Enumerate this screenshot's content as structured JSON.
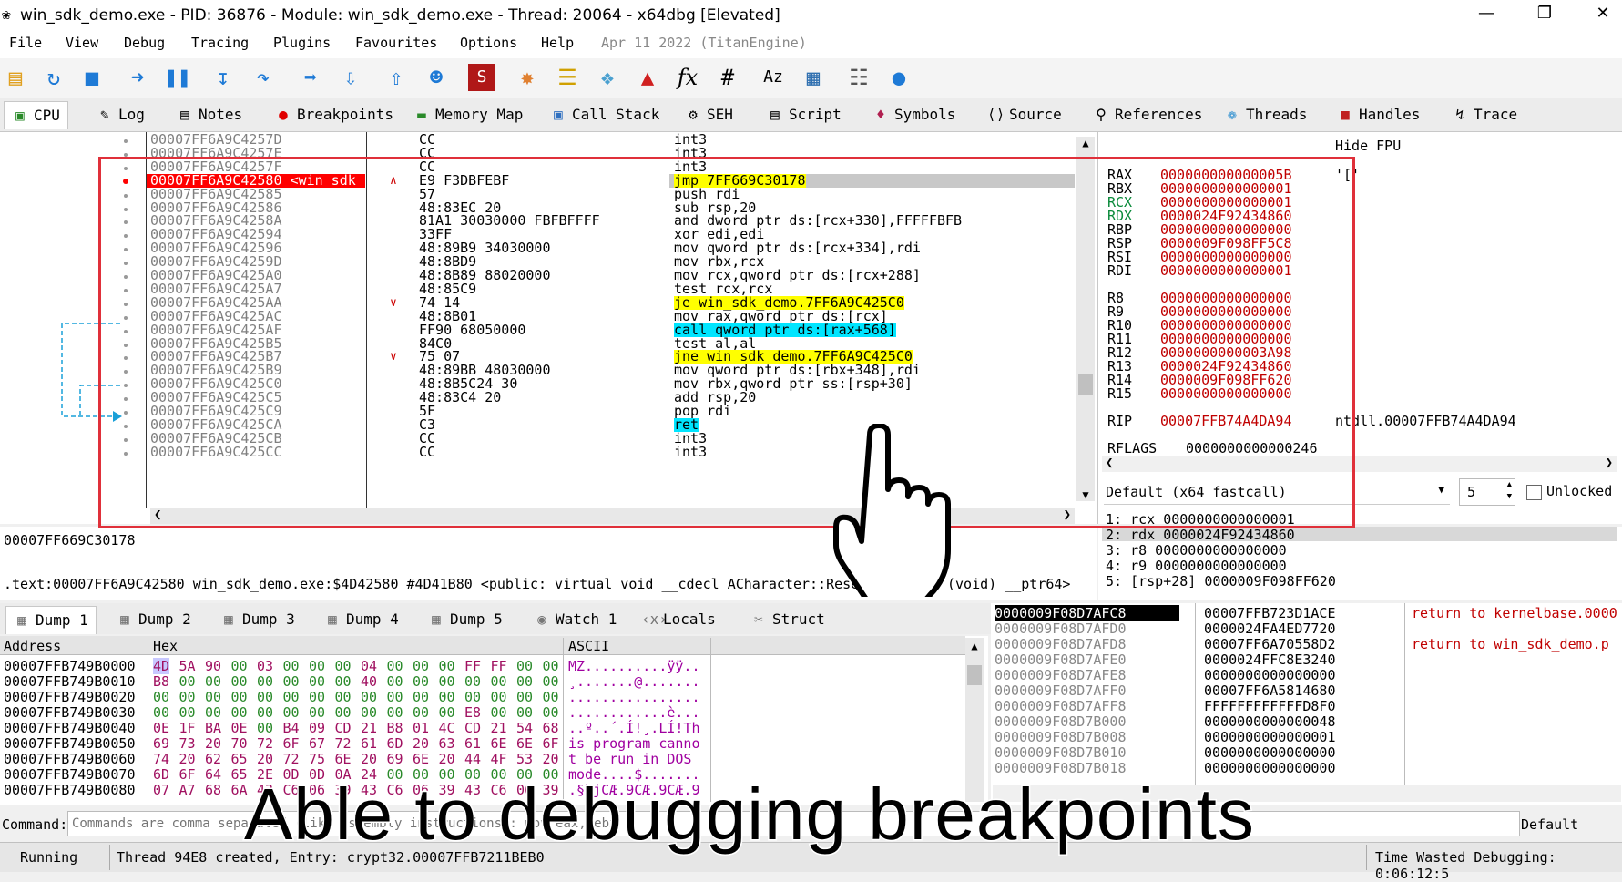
{
  "window": {
    "title": "win_sdk_demo.exe - PID: 36876 - Module: win_sdk_demo.exe - Thread: 20064 - x64dbg [Elevated]"
  },
  "menu": [
    "File",
    "View",
    "Debug",
    "Tracing",
    "Plugins",
    "Favourites",
    "Options",
    "Help"
  ],
  "menu_date": "Apr 11 2022 (TitanEngine)",
  "toolbar_icons": [
    "open-icon",
    "restart-icon",
    "stop-icon",
    "run-icon",
    "pause-icon",
    "step-into-icon",
    "step-over-icon",
    "trace-into-icon",
    "trace-over-icon",
    "execute-till-return-icon",
    "run-to-user-code-icon",
    "script-icon",
    "patch-icon",
    "comment-icon",
    "label-icon",
    "bookmark-icon",
    "function-icon",
    "hash-icon",
    "font-icon",
    "calculator-icon",
    "settings-icon",
    "globe-icon"
  ],
  "toolbar_glyphs": {
    "fx": "fx",
    "hash": "#",
    "font": "Az"
  },
  "tabs": [
    {
      "label": "CPU",
      "icon": "cpu-icon"
    },
    {
      "label": "Log",
      "icon": "log-icon"
    },
    {
      "label": "Notes",
      "icon": "notes-icon"
    },
    {
      "label": "Breakpoints",
      "icon": "breakpoint-icon"
    },
    {
      "label": "Memory Map",
      "icon": "memory-icon"
    },
    {
      "label": "Call Stack",
      "icon": "callstack-icon"
    },
    {
      "label": "SEH",
      "icon": "seh-icon"
    },
    {
      "label": "Script",
      "icon": "script-icon"
    },
    {
      "label": "Symbols",
      "icon": "symbols-icon"
    },
    {
      "label": "Source",
      "icon": "source-icon"
    },
    {
      "label": "References",
      "icon": "references-icon"
    },
    {
      "label": "Threads",
      "icon": "threads-icon"
    },
    {
      "label": "Handles",
      "icon": "handles-icon"
    },
    {
      "label": "Trace",
      "icon": "trace-icon"
    }
  ],
  "disasm": [
    {
      "addr": "00007FF6A9C4257D",
      "bytes": "CC",
      "asm": "int3"
    },
    {
      "addr": "00007FF6A9C4257E",
      "bytes": "CC",
      "asm": "int3"
    },
    {
      "addr": "00007FF6A9C4257F",
      "bytes": "CC",
      "asm": "int3"
    },
    {
      "addr": "00007FF6A9C42580 <win_sdk_",
      "bytes": "E9 F3DBFEBF",
      "asm": "jmp 7FF669C30178",
      "bp": true
    },
    {
      "addr": "00007FF6A9C42585",
      "bytes": "57",
      "asm": "push rdi"
    },
    {
      "addr": "00007FF6A9C42586",
      "bytes": "48:83EC 20",
      "asm": "sub rsp,20"
    },
    {
      "addr": "00007FF6A9C4258A",
      "bytes": "81A1 30030000 FBFBFFFF",
      "asm": "and dword ptr ds:[rcx+330],FFFFFBFB"
    },
    {
      "addr": "00007FF6A9C42594",
      "bytes": "33FF",
      "asm": "xor edi,edi"
    },
    {
      "addr": "00007FF6A9C42596",
      "bytes": "48:89B9 34030000",
      "asm": "mov qword ptr ds:[rcx+334],rdi"
    },
    {
      "addr": "00007FF6A9C4259D",
      "bytes": "48:8BD9",
      "asm": "mov rbx,rcx"
    },
    {
      "addr": "00007FF6A9C425A0",
      "bytes": "48:8B89 88020000",
      "asm": "mov rcx,qword ptr ds:[rcx+288]"
    },
    {
      "addr": "00007FF6A9C425A7",
      "bytes": "48:85C9",
      "asm": "test rcx,rcx"
    },
    {
      "addr": "00007FF6A9C425AA",
      "bytes": "74 14",
      "asm": "je win_sdk_demo.7FF6A9C425C0"
    },
    {
      "addr": "00007FF6A9C425AC",
      "bytes": "48:8B01",
      "asm": "mov rax,qword ptr ds:[rcx]"
    },
    {
      "addr": "00007FF6A9C425AF",
      "bytes": "FF90 68050000",
      "asm": "call qword ptr ds:[rax+568]"
    },
    {
      "addr": "00007FF6A9C425B5",
      "bytes": "84C0",
      "asm": "test al,al"
    },
    {
      "addr": "00007FF6A9C425B7",
      "bytes": "75 07",
      "asm": "jne win_sdk_demo.7FF6A9C425C0"
    },
    {
      "addr": "00007FF6A9C425B9",
      "bytes": "48:89BB 48030000",
      "asm": "mov qword ptr ds:[rbx+348],rdi"
    },
    {
      "addr": "00007FF6A9C425C0",
      "bytes": "48:8B5C24 30",
      "asm": "mov rbx,qword ptr ss:[rsp+30]"
    },
    {
      "addr": "00007FF6A9C425C5",
      "bytes": "48:83C4 20",
      "asm": "add rsp,20"
    },
    {
      "addr": "00007FF6A9C425C9",
      "bytes": "5F",
      "asm": "pop rdi"
    },
    {
      "addr": "00007FF6A9C425CA",
      "bytes": "C3",
      "asm": "ret"
    },
    {
      "addr": "00007FF6A9C425CB",
      "bytes": "CC",
      "asm": "int3"
    },
    {
      "addr": "00007FF6A9C425CC",
      "bytes": "CC",
      "asm": "int3"
    }
  ],
  "regs_header": "Hide FPU",
  "regs": [
    {
      "n": "RAX",
      "v": "000000000000005B",
      "extra": "'['"
    },
    {
      "n": "RBX",
      "v": "0000000000000001"
    },
    {
      "n": "RCX",
      "v": "0000000000000001"
    },
    {
      "n": "RDX",
      "v": "0000024F92434860"
    },
    {
      "n": "RBP",
      "v": "0000000000000000"
    },
    {
      "n": "RSP",
      "v": "0000009F098FF5C8"
    },
    {
      "n": "RSI",
      "v": "0000000000000000"
    },
    {
      "n": "RDI",
      "v": "0000000000000001"
    },
    {
      "n": "R8",
      "v": "0000000000000000"
    },
    {
      "n": "R9",
      "v": "0000000000000000"
    },
    {
      "n": "R10",
      "v": "0000000000000000"
    },
    {
      "n": "R11",
      "v": "0000000000000000"
    },
    {
      "n": "R12",
      "v": "0000000000003A98"
    },
    {
      "n": "R13",
      "v": "0000024F92434860"
    },
    {
      "n": "R14",
      "v": "0000009F098FF620"
    },
    {
      "n": "R15",
      "v": "0000000000000000"
    },
    {
      "n": "RIP",
      "v": "00007FFB74A4DA94",
      "extra": "ntdll.00007FFB74A4DA94"
    },
    {
      "n": "RFLAGS",
      "v": "0000000000000246"
    }
  ],
  "callconv": {
    "label": "Default (x64 fastcall)",
    "count": "5",
    "unlocked": "Unlocked"
  },
  "args": [
    "1: rcx 0000000000000001",
    "2: rdx 0000024F92434860",
    "3: r8 0000000000000000",
    "4: r9 0000000000000000",
    "5: [rsp+28] 0000009F098FF620"
  ],
  "info": {
    "line1": "00007FF669C30178",
    "line2": ".text:00007FF6A9C42580 win_sdk_demo.exe:$4D42580 #4D41B80 <public: virtual void __cdecl ACharacter::ResetI",
    "line2b": "(void) __ptr64>"
  },
  "bottom_tabs": [
    {
      "label": "Dump 1",
      "icon": "dump-icon"
    },
    {
      "label": "Dump 2",
      "icon": "dump-icon"
    },
    {
      "label": "Dump 3",
      "icon": "dump-icon"
    },
    {
      "label": "Dump 4",
      "icon": "dump-icon"
    },
    {
      "label": "Dump 5",
      "icon": "dump-icon"
    },
    {
      "label": "Watch 1",
      "icon": "watch-icon"
    },
    {
      "label": "Locals",
      "icon": "locals-icon"
    },
    {
      "label": "Struct",
      "icon": "struct-icon"
    }
  ],
  "dump_headers": {
    "address": "Address",
    "hex": "Hex",
    "ascii": "ASCII"
  },
  "dump": [
    {
      "a": "00007FFB749B0000",
      "h": [
        "4D",
        "5A",
        "90",
        "00",
        "03",
        "00",
        "00",
        "00",
        "04",
        "00",
        "00",
        "00",
        "FF",
        "FF",
        "00",
        "00"
      ],
      "s": "MZ..........ÿÿ.."
    },
    {
      "a": "00007FFB749B0010",
      "h": [
        "B8",
        "00",
        "00",
        "00",
        "00",
        "00",
        "00",
        "00",
        "40",
        "00",
        "00",
        "00",
        "00",
        "00",
        "00",
        "00"
      ],
      "s": "¸.......@......."
    },
    {
      "a": "00007FFB749B0020",
      "h": [
        "00",
        "00",
        "00",
        "00",
        "00",
        "00",
        "00",
        "00",
        "00",
        "00",
        "00",
        "00",
        "00",
        "00",
        "00",
        "00"
      ],
      "s": "................"
    },
    {
      "a": "00007FFB749B0030",
      "h": [
        "00",
        "00",
        "00",
        "00",
        "00",
        "00",
        "00",
        "00",
        "00",
        "00",
        "00",
        "00",
        "E8",
        "00",
        "00",
        "00"
      ],
      "s": "............è..."
    },
    {
      "a": "00007FFB749B0040",
      "h": [
        "0E",
        "1F",
        "BA",
        "0E",
        "00",
        "B4",
        "09",
        "CD",
        "21",
        "B8",
        "01",
        "4C",
        "CD",
        "21",
        "54",
        "68"
      ],
      "s": "..º..´.Í!¸.LÍ!Th"
    },
    {
      "a": "00007FFB749B0050",
      "h": [
        "69",
        "73",
        "20",
        "70",
        "72",
        "6F",
        "67",
        "72",
        "61",
        "6D",
        "20",
        "63",
        "61",
        "6E",
        "6E",
        "6F"
      ],
      "s": "is program canno"
    },
    {
      "a": "00007FFB749B0060",
      "h": [
        "74",
        "20",
        "62",
        "65",
        "20",
        "72",
        "75",
        "6E",
        "20",
        "69",
        "6E",
        "20",
        "44",
        "4F",
        "53",
        "20"
      ],
      "s": "t be run in DOS "
    },
    {
      "a": "00007FFB749B0070",
      "h": [
        "6D",
        "6F",
        "64",
        "65",
        "2E",
        "0D",
        "0D",
        "0A",
        "24",
        "00",
        "00",
        "00",
        "00",
        "00",
        "00",
        "00"
      ],
      "s": "mode....$......."
    },
    {
      "a": "00007FFB749B0080",
      "h": [
        "07",
        "A7",
        "68",
        "6A",
        "43",
        "C6",
        "06",
        "39",
        "43",
        "C6",
        "06",
        "39",
        "43",
        "C6",
        "06",
        "39"
      ],
      "s": ".§hjCÆ.9CÆ.9CÆ.9"
    }
  ],
  "stack": [
    {
      "a": "0000009F08D7AFC8",
      "v": "00007FFB723D1ACE",
      "c": "return to kernelbase.0000"
    },
    {
      "a": "0000009F08D7AFD0",
      "v": "0000024FA4ED7720",
      "c": ""
    },
    {
      "a": "0000009F08D7AFD8",
      "v": "00007FF6A70558D2",
      "c": "return to win_sdk_demo.p"
    },
    {
      "a": "0000009F08D7AFE0",
      "v": "0000024FFC8E3240",
      "c": ""
    },
    {
      "a": "0000009F08D7AFE8",
      "v": "0000000000000000",
      "c": ""
    },
    {
      "a": "0000009F08D7AFF0",
      "v": "00007FF6A5814680",
      "c": ""
    },
    {
      "a": "0000009F08D7AFF8",
      "v": "FFFFFFFFFFFFD8F0",
      "c": ""
    },
    {
      "a": "0000009F08D7B000",
      "v": "0000000000000048",
      "c": ""
    },
    {
      "a": "0000009F08D7B008",
      "v": "0000000000000001",
      "c": ""
    },
    {
      "a": "0000009F08D7B010",
      "v": "0000000000000000",
      "c": ""
    },
    {
      "a": "0000009F08D7B018",
      "v": "0000000000000000",
      "c": ""
    }
  ],
  "command": {
    "label": "Command:",
    "placeholder": "Commands are comma separated (like assembly instructions): mov eax, ebx",
    "default": "Default"
  },
  "status": {
    "state": "Running",
    "message": "Thread 94E8 created, Entry: crypt32.00007FFB7211BEB0",
    "time": "Time Wasted Debugging: 0:06:12:5"
  },
  "caption": "Able to debugging breakpoints",
  "colors": {
    "breakpoint": "#ff0000",
    "highlight_box": "#e0303a",
    "register_value": "#c00000",
    "jump_highlight": "#ffff00",
    "call_highlight": "#00e5ff"
  }
}
